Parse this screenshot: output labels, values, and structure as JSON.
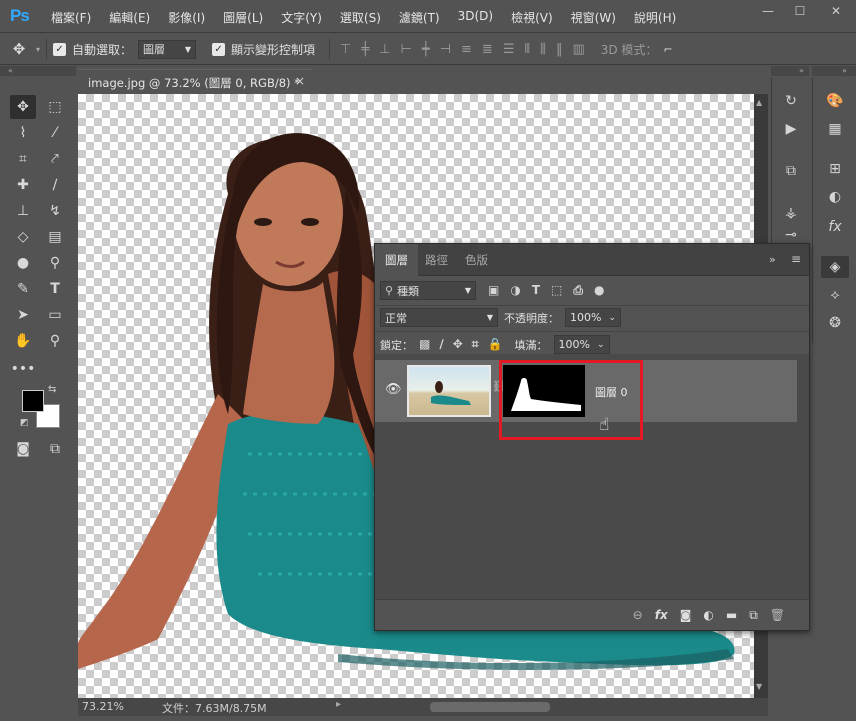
{
  "app": {
    "logo": "Ps",
    "menu": [
      "檔案(F)",
      "編輯(E)",
      "影像(I)",
      "圖層(L)",
      "文字(Y)",
      "選取(S)",
      "濾鏡(T)",
      "3D(D)",
      "檢視(V)",
      "視窗(W)",
      "說明(H)"
    ],
    "window_controls": {
      "minimize": "—",
      "restore": "☐",
      "close": "✕"
    }
  },
  "options_bar": {
    "auto_select_label": "自動選取：",
    "auto_select_value": "圖層",
    "show_transform_label": "顯示變形控制項",
    "mode_3d_label": "3D 模式："
  },
  "document": {
    "tab_title": "image.jpg @ 73.2% (圖層 0, RGB/8) *",
    "tab_close": "×",
    "zoom": "73.21%",
    "file_info": "文件：7.63M/8.75M"
  },
  "layers_panel": {
    "tabs": [
      "圖層",
      "路徑",
      "色版"
    ],
    "filter_kind": "種類",
    "blend_mode": "正常",
    "opacity_label": "不透明度：",
    "opacity_value": "100%",
    "lock_label": "鎖定：",
    "fill_label": "填滿：",
    "fill_value": "100%",
    "layer_name": "圖層 0",
    "footer_icons": [
      "link-icon",
      "fx-icon",
      "mask-icon",
      "adjustment-icon",
      "folder-icon",
      "new-layer-icon",
      "trash-icon"
    ]
  },
  "colors": {
    "accent_logo": "#31a8ff",
    "highlight_box": "#e21b23",
    "dress": "#1a8a8a"
  }
}
